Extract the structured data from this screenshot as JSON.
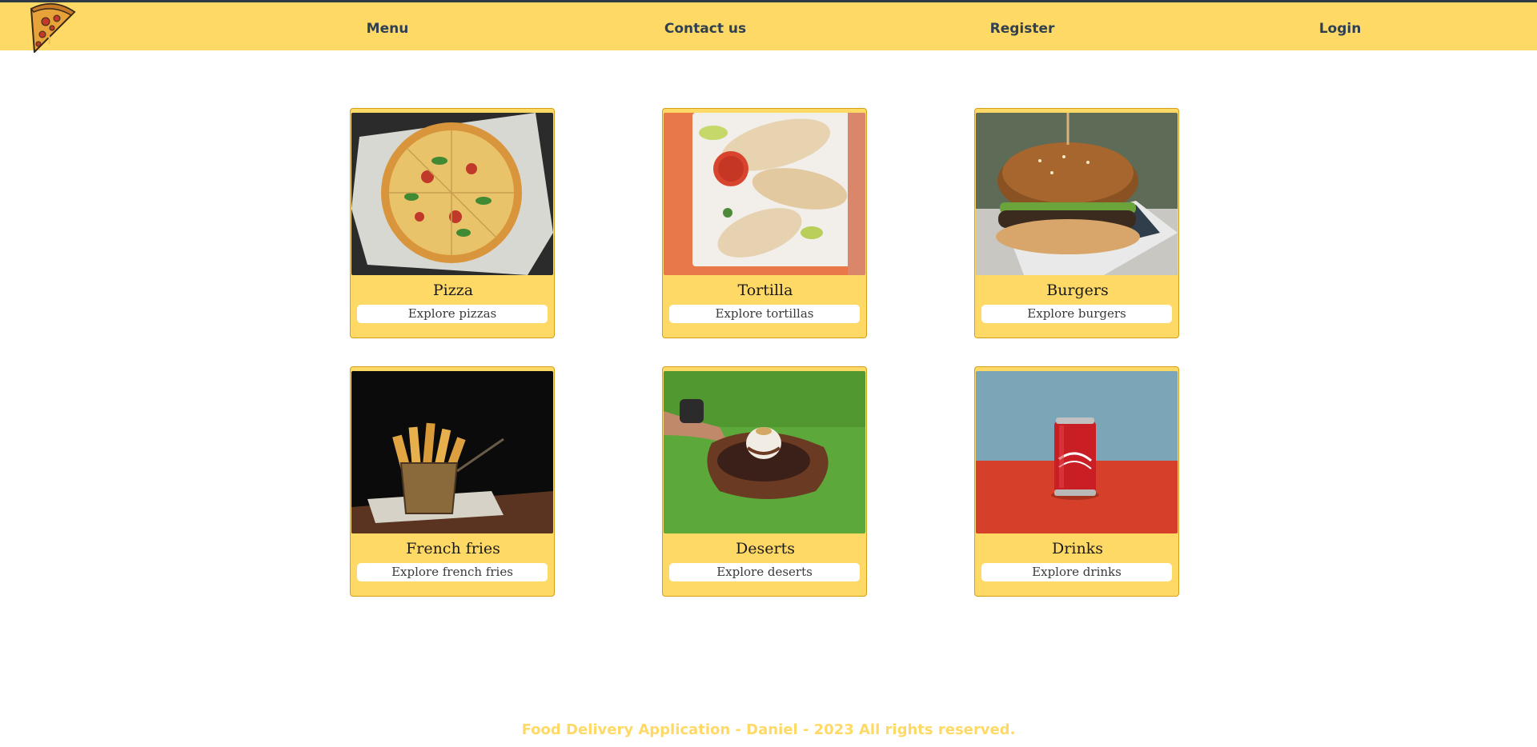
{
  "navbar": {
    "logo_icon": "pizza-slice-icon",
    "items": [
      {
        "label": "Menu"
      },
      {
        "label": "Contact us"
      },
      {
        "label": "Register"
      },
      {
        "label": "Login"
      }
    ]
  },
  "categories": [
    {
      "title": "Pizza",
      "button": "Explore pizzas",
      "image": "pizza-photo"
    },
    {
      "title": "Tortilla",
      "button": "Explore tortillas",
      "image": "tortilla-photo"
    },
    {
      "title": "Burgers",
      "button": "Explore burgers",
      "image": "burger-photo"
    },
    {
      "title": "French fries",
      "button": "Explore french fries",
      "image": "french-fries-photo"
    },
    {
      "title": "Deserts",
      "button": "Explore deserts",
      "image": "dessert-photo"
    },
    {
      "title": "Drinks",
      "button": "Explore drinks",
      "image": "cola-can-photo"
    }
  ],
  "footer": {
    "text": "Food Delivery Application - Daniel - 2023 All rights reserved."
  },
  "colors": {
    "accent": "#ffd966",
    "nav_text": "#2f4050",
    "border": "#d4a017",
    "top_line": "#2e3a47"
  }
}
